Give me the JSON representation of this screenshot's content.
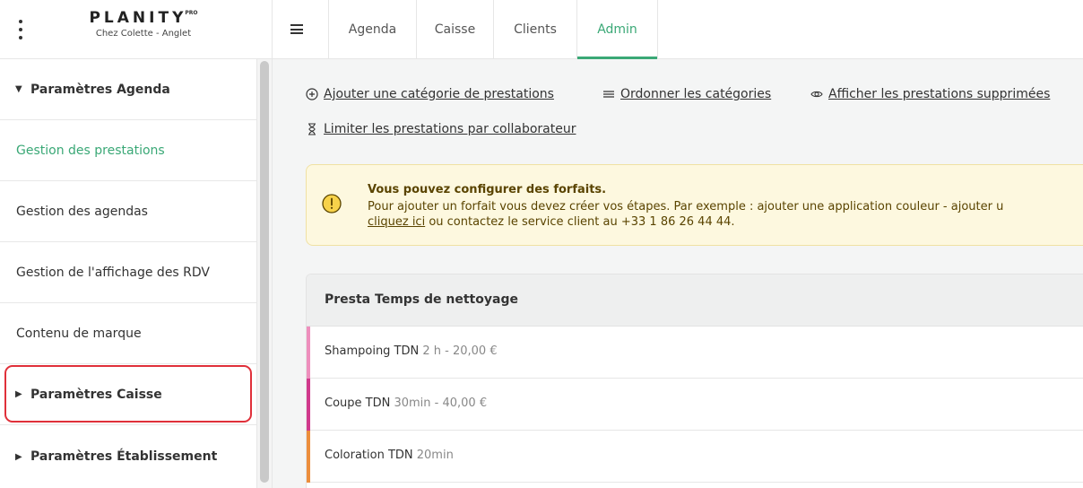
{
  "header": {
    "logo": "PLANITY",
    "logo_badge": "PRO",
    "salon_name": "Chez Colette - Anglet",
    "tabs": [
      {
        "label": "Agenda",
        "active": false
      },
      {
        "label": "Caisse",
        "active": false
      },
      {
        "label": "Clients",
        "active": false
      },
      {
        "label": "Admin",
        "active": true
      }
    ]
  },
  "sidebar": {
    "section_agenda": "Paramètres Agenda",
    "items": [
      {
        "label": "Gestion des prestations",
        "active": true
      },
      {
        "label": "Gestion des agendas",
        "active": false
      },
      {
        "label": "Gestion de l'affichage des RDV",
        "active": false
      },
      {
        "label": "Contenu de marque",
        "active": false
      }
    ],
    "section_caisse": "Paramètres Caisse",
    "section_etablissement": "Paramètres Établissement"
  },
  "main": {
    "actions": {
      "add_category": "Ajouter une catégorie de prestations",
      "order_categories": "Ordonner les catégories",
      "show_deleted": "Afficher les prestations supprimées",
      "limit_per_staff": "Limiter les prestations par collaborateur"
    },
    "notice": {
      "title": "Vous pouvez configurer des forfaits.",
      "line1": "Pour ajouter un forfait vous devez créer vos étapes. Par exemple : ajouter une application couleur - ajouter u",
      "link": "cliquez ici",
      "line2_rest": " ou contactez le service client au +33 1 86 26 44 44."
    },
    "category": {
      "title": "Presta Temps de nettoyage",
      "services": [
        {
          "name": "Shampoing TDN",
          "meta": "2 h - 20,00 €",
          "color": "#ee8fbd"
        },
        {
          "name": "Coupe TDN",
          "meta": "30min - 40,00 €",
          "color": "#d0398c"
        },
        {
          "name": "Coloration TDN",
          "meta": "20min",
          "color": "#ec8e3c"
        }
      ]
    }
  },
  "colors": {
    "accent": "#3aa876",
    "highlight": "#e0303a",
    "notice_bg": "#fdf8df"
  }
}
